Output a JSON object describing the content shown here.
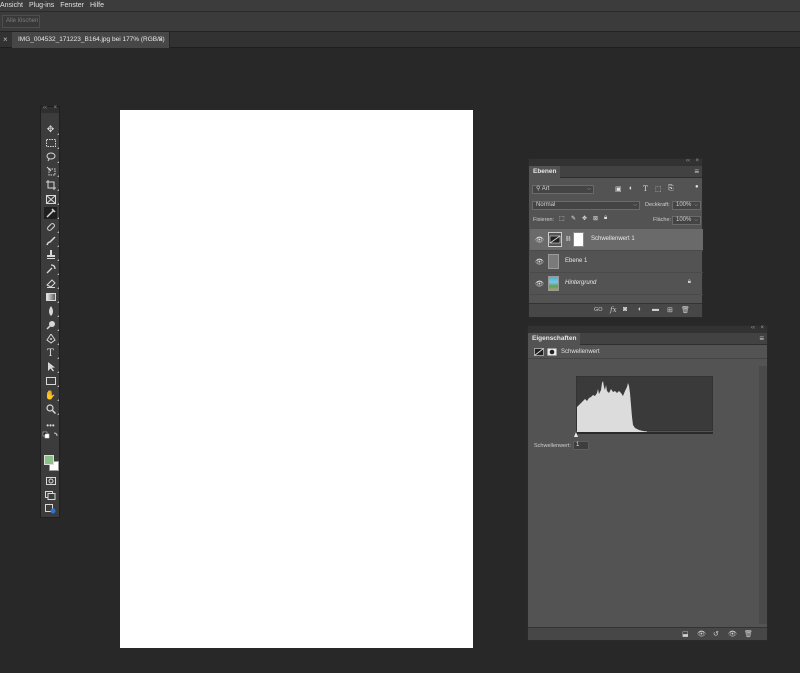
{
  "menubar": [
    "Ansicht",
    "Plug-ins",
    "Fenster",
    "Hilfe"
  ],
  "optionsbar": {
    "button": "Alle löschen"
  },
  "document_tab": {
    "label": "IMG_004532_171223_B164.jpg bei 177% (RGB/8)",
    "close": "×"
  },
  "tab_close_left": "×",
  "layers_panel": {
    "title": "Ebenen",
    "filter_kind": "Art",
    "blend_mode": "Normal",
    "opacity_label": "Deckkraft:",
    "opacity_value": "100%",
    "lock_label": "Fixieren:",
    "fill_label": "Fläche:",
    "fill_value": "100%",
    "layers": [
      {
        "name": "Schwellenwert 1",
        "active": true
      },
      {
        "name": "Ebene 1",
        "active": false
      },
      {
        "name": "Hintergrund",
        "active": false,
        "locked": true
      }
    ]
  },
  "properties_panel": {
    "title": "Eigenschaften",
    "adjustment_name": "Schwellenwert",
    "threshold_label": "Schwellenwert:",
    "threshold_value": "1"
  },
  "colors": {
    "foreground": "#8dbf8a",
    "background": "#ffffff"
  }
}
